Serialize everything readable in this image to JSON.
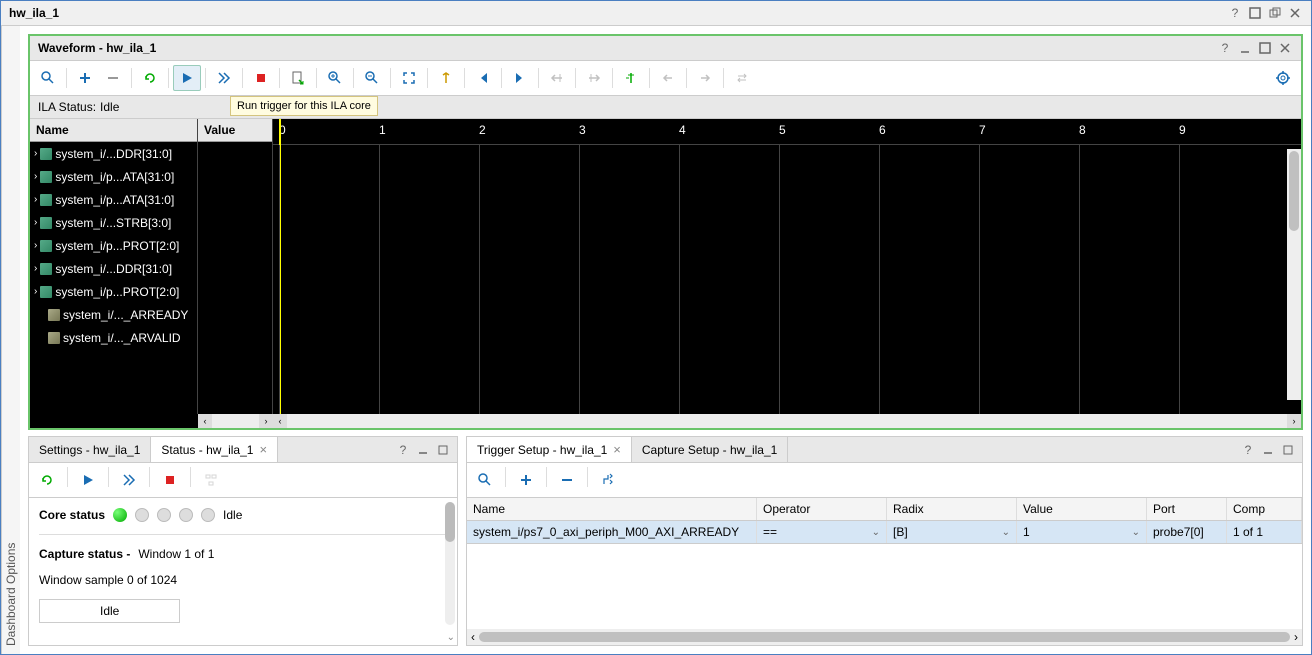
{
  "window": {
    "title": "hw_ila_1"
  },
  "side_tab": "Dashboard Options",
  "waveform": {
    "title": "Waveform - hw_ila_1",
    "status_label": "ILA Status:",
    "status_value": "Idle",
    "tooltip": "Run trigger for this ILA core",
    "columns": {
      "name": "Name",
      "value": "Value"
    },
    "signals": [
      {
        "name": "system_i/...DDR[31:0]",
        "type": "bus",
        "expandable": true
      },
      {
        "name": "system_i/p...ATA[31:0]",
        "type": "bus",
        "expandable": true
      },
      {
        "name": "system_i/p...ATA[31:0]",
        "type": "bus",
        "expandable": true
      },
      {
        "name": "system_i/...STRB[3:0]",
        "type": "bus",
        "expandable": true
      },
      {
        "name": "system_i/p...PROT[2:0]",
        "type": "bus",
        "expandable": true
      },
      {
        "name": "system_i/...DDR[31:0]",
        "type": "bus",
        "expandable": true
      },
      {
        "name": "system_i/p...PROT[2:0]",
        "type": "bus",
        "expandable": true
      },
      {
        "name": "system_i/..._ARREADY",
        "type": "sig",
        "expandable": false
      },
      {
        "name": "system_i/..._ARVALID",
        "type": "sig",
        "expandable": false
      }
    ],
    "ruler_ticks": [
      "0",
      "1",
      "2",
      "3",
      "4",
      "5",
      "6",
      "7",
      "8",
      "9"
    ],
    "cursor_pos": "0"
  },
  "left_tabs": {
    "settings": "Settings - hw_ila_1",
    "status": "Status - hw_ila_1"
  },
  "status": {
    "core_status_label": "Core status",
    "core_status_text": "Idle",
    "capture_label": "Capture status -",
    "capture_window": "Window 1 of 1",
    "sample": "Window sample 0 of 1024",
    "idle": "Idle"
  },
  "right_tabs": {
    "trigger": "Trigger Setup - hw_ila_1",
    "capture": "Capture Setup - hw_ila_1"
  },
  "trigger": {
    "headers": {
      "name": "Name",
      "operator": "Operator",
      "radix": "Radix",
      "value": "Value",
      "port": "Port",
      "comp": "Comp"
    },
    "row": {
      "name": "system_i/ps7_0_axi_periph_M00_AXI_ARREADY",
      "operator": "==",
      "radix": "[B]",
      "value": "1",
      "port": "probe7[0]",
      "comp": "1 of 1"
    }
  }
}
